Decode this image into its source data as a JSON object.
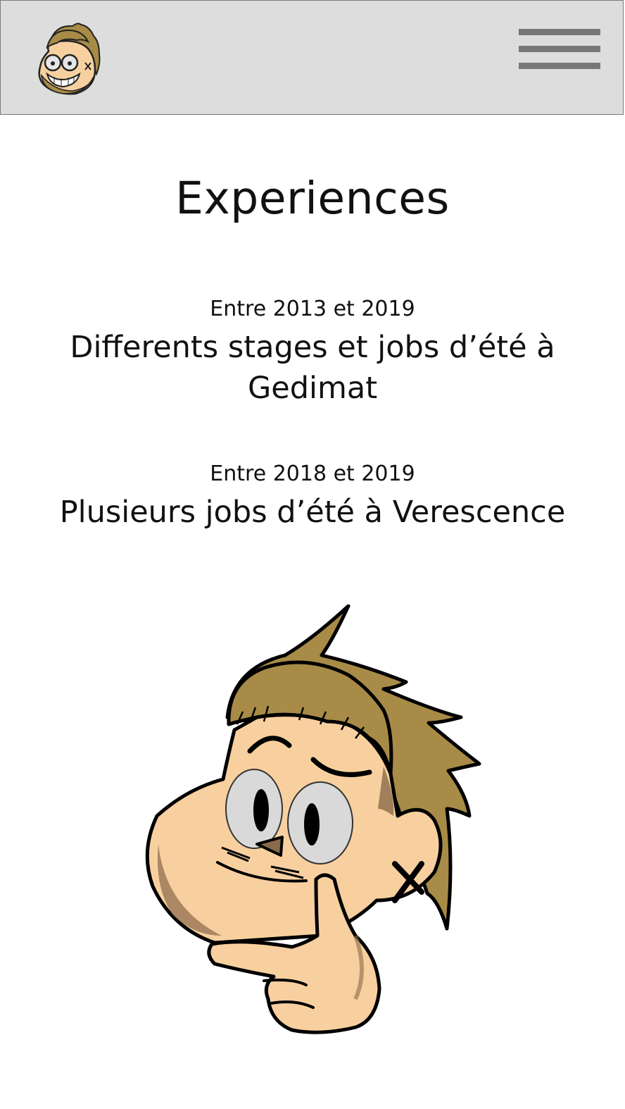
{
  "header": {
    "logo_icon": "mascot-face-icon",
    "menu_icon": "hamburger-menu-icon"
  },
  "main": {
    "title": "Experiences",
    "experiences": [
      {
        "date": "Entre 2013 et 2019",
        "title": "Differents stages et jobs d’été à Gedimat"
      },
      {
        "date": "Entre 2018 et 2019",
        "title": "Plusieurs jobs d’été à Verescence"
      }
    ],
    "illustration_icon": "thinking-mascot-icon"
  },
  "colors": {
    "header_bg": "#dddddd",
    "header_border": "#7a7a7a",
    "menu_bars": "#777777",
    "text": "#111111",
    "hair": "#a78b47",
    "skin": "#f8d0a0",
    "eye_white": "#d9d9d9"
  }
}
